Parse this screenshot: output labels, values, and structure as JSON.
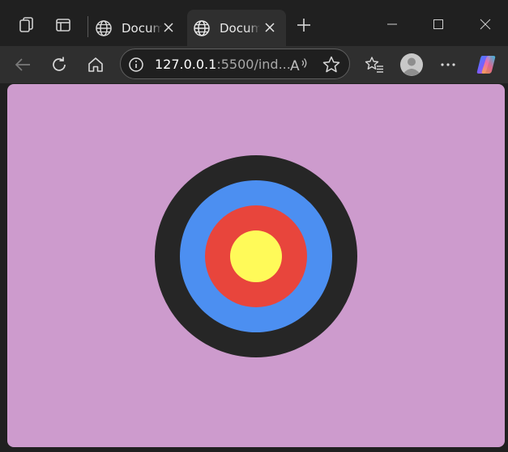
{
  "tabs": [
    {
      "title": "Document"
    },
    {
      "title": "Document"
    }
  ],
  "address_bar": {
    "host": "127.0.0.1",
    "path": ":5500/ind..."
  },
  "page": {
    "background_color": "#cd9bcd",
    "target_rings": [
      {
        "name": "outer",
        "color": "#262626"
      },
      {
        "name": "blue",
        "color": "#4c8ff1"
      },
      {
        "name": "red",
        "color": "#e8453c"
      },
      {
        "name": "center",
        "color": "#fffa59"
      }
    ]
  },
  "icons": {
    "workspaces": "workspaces-icon",
    "vertical_tabs": "tab-actions-icon",
    "back": "back-arrow-icon",
    "refresh": "refresh-icon",
    "home": "home-icon",
    "site_info": "info-icon",
    "read_aloud": "read-aloud-icon",
    "favorite": "star-icon",
    "favorites": "favorites-icon",
    "profile": "profile-icon",
    "more": "more-icon",
    "copilot": "copilot-icon"
  }
}
